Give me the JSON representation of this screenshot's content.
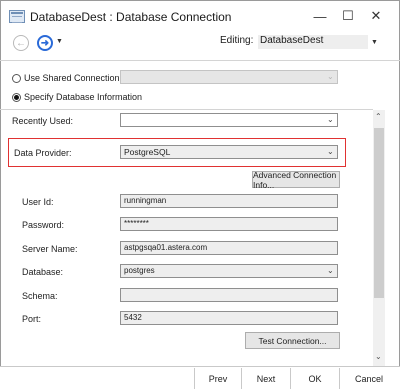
{
  "window": {
    "title": "DatabaseDest : Database Connection",
    "minimize_glyph": "—",
    "maximize_glyph": "☐",
    "close_glyph": "✕"
  },
  "toolbar": {
    "back_glyph": "←",
    "forward_glyph": "➜",
    "dropdown_glyph": "▼",
    "editing_label": "Editing:",
    "editing_value": "DatabaseDest"
  },
  "connection_source": {
    "use_shared_label": "Use Shared Connection",
    "use_shared_checked": false,
    "shared_value": "",
    "specify_label": "Specify Database Information",
    "specify_checked": true
  },
  "recently_used": {
    "label": "Recently Used:",
    "value": ""
  },
  "data_provider": {
    "label": "Data Provider:",
    "value": "PostgreSQL"
  },
  "advanced_button": "Advanced Connection Info...",
  "fields": {
    "user_id": {
      "label": "User Id:",
      "value": "runningman"
    },
    "password": {
      "label": "Password:",
      "value": "********"
    },
    "server_name": {
      "label": "Server Name:",
      "value": "astpgsqa01.astera.com"
    },
    "database": {
      "label": "Database:",
      "value": "postgres"
    },
    "schema": {
      "label": "Schema:",
      "value": ""
    },
    "port": {
      "label": "Port:",
      "value": "5432"
    }
  },
  "test_button": "Test Connection...",
  "footer": {
    "prev": "Prev",
    "next": "Next",
    "ok": "OK",
    "cancel": "Cancel"
  },
  "scrollbar": {
    "up_glyph": "⌃",
    "down_glyph": "⌄"
  },
  "icons": {
    "app": "database-connection-icon",
    "dropdown_caret": "chevron-down-icon"
  },
  "colors": {
    "highlight_border": "#e03232",
    "forward_accent": "#2a6ad8",
    "field_background": "#eeeeee"
  }
}
